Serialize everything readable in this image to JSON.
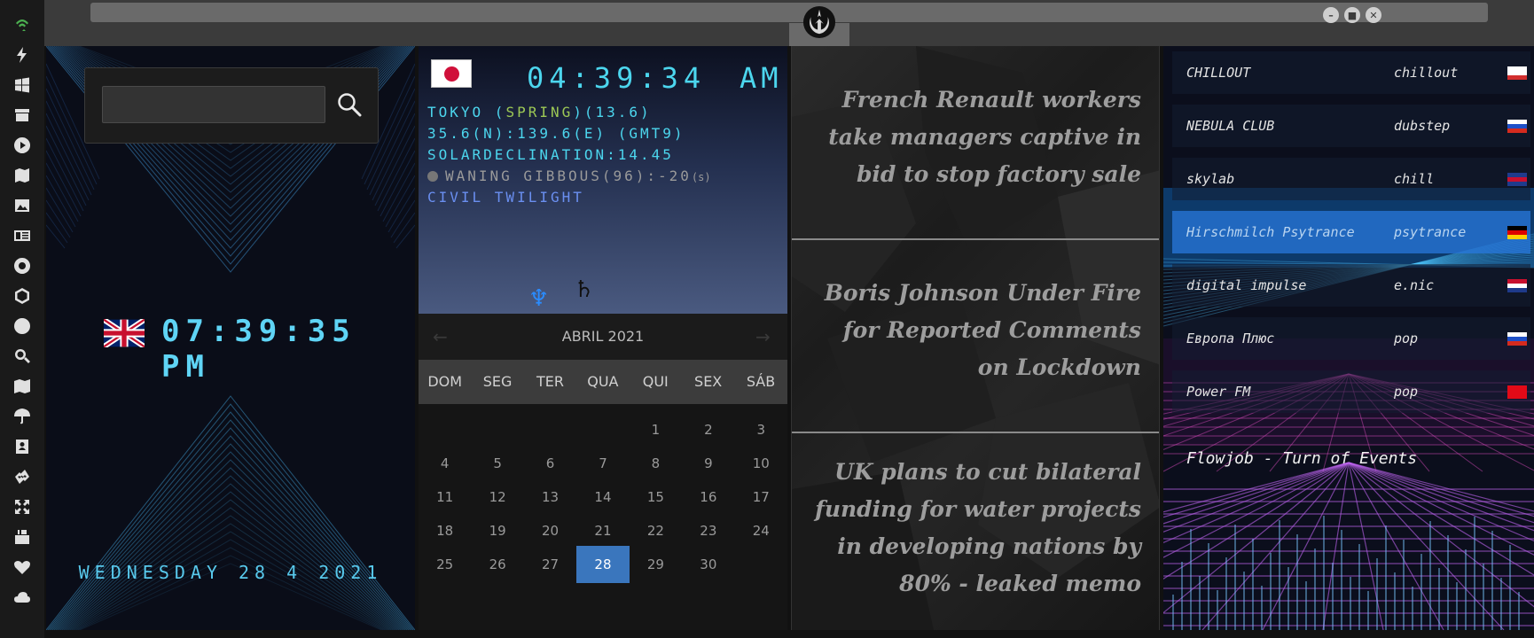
{
  "sidebar": {
    "icons": [
      "wifi-icon",
      "lightning-icon",
      "windows-icon",
      "archive-icon",
      "play-icon",
      "map-book-icon",
      "image-icon",
      "news-icon",
      "aperture-icon",
      "hexagon-icon",
      "globe-icon",
      "search-icon",
      "map-icon",
      "umbrella-icon",
      "contacts-icon",
      "link-icon",
      "expand-icon",
      "youtube-icon",
      "heart-icon",
      "cloud-icon"
    ],
    "accent": "#4caf50"
  },
  "titlebar": {
    "emblem": "rebel-alliance-icon"
  },
  "clock_panel": {
    "search": {
      "value": "",
      "placeholder": ""
    },
    "local_flag": "uk-flag",
    "local_time": "07:39:35 PM",
    "date": "WEDNESDAY 28 4 2021"
  },
  "tokyo_panel": {
    "time": "04:39:34",
    "ampm": "AM",
    "line1_a": "TOKYO (",
    "line1_season": "SPRING",
    "line1_b": ")(13.6)",
    "line2": "35.6(N):139.6(E) (GMT9)",
    "line3": "SOLARDECLINATION:14.45",
    "moon": "WANING GIBBOUS(96):-20",
    "moon_unit": "(s)",
    "twilight": "CIVIL TWILIGHT"
  },
  "calendar": {
    "month": "ABRIL 2021",
    "prev": "←",
    "next": "→",
    "weekdays": [
      "DOM",
      "SEG",
      "TER",
      "QUA",
      "QUI",
      "SEX",
      "SÁB"
    ],
    "first_weekday": 4,
    "days_in_month": 30,
    "today": 28
  },
  "news": [
    "French Renault workers take managers captive in bid to stop factory sale",
    "Boris Johnson Under Fire for Reported Comments on Lockdown",
    "UK plans to cut bilateral funding for water projects in developing nations by 80% - leaked memo"
  ],
  "radio": {
    "stations": [
      {
        "name": "CHILLOUT",
        "genre": "chillout",
        "flag": [
          "#ffffff",
          "#ffffff",
          "#d32f2f"
        ]
      },
      {
        "name": "NEBULA CLUB",
        "genre": "dubstep",
        "flag": [
          "#ffffff",
          "#1e50c8",
          "#d52b1e"
        ]
      },
      {
        "name": "skylab",
        "genre": "chill",
        "flag": [
          "#1f3b8c",
          "#c8102e",
          "#1f3b8c"
        ]
      },
      {
        "name": "Hirschmilch Psytrance",
        "genre": "psytrance",
        "flag": [
          "#000000",
          "#dd0000",
          "#ffce00"
        ],
        "active": true
      },
      {
        "name": "digital impulse",
        "genre": "e.nic",
        "flag": [
          "#c8102e",
          "#ffffff",
          "#1e3a8a"
        ]
      },
      {
        "name": "Европа Плюс",
        "genre": "pop",
        "flag": [
          "#ffffff",
          "#1e50c8",
          "#d52b1e"
        ]
      },
      {
        "name": "Power FM",
        "genre": "pop",
        "flag": [
          "#e30a17",
          "#e30a17",
          "#e30a17"
        ]
      }
    ],
    "now_playing": "Flowjob - Turn of Events"
  }
}
